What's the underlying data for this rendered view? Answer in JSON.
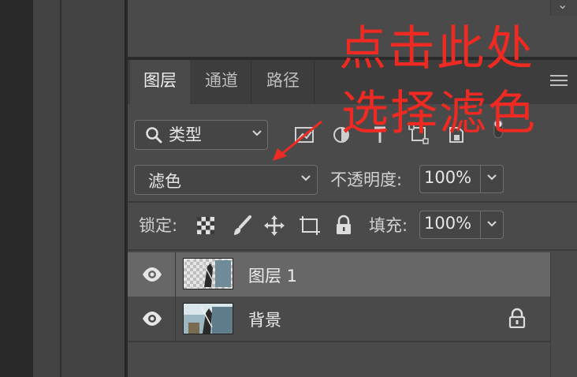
{
  "tabs": [
    {
      "label": "图层",
      "active": true
    },
    {
      "label": "通道",
      "active": false
    },
    {
      "label": "路径",
      "active": false
    }
  ],
  "filter": {
    "label": "类型",
    "icon": "search-icon"
  },
  "blend_mode": {
    "value": "滤色"
  },
  "opacity": {
    "label": "不透明度:",
    "value": "100%"
  },
  "lock": {
    "label": "锁定:"
  },
  "fill": {
    "label": "填充:",
    "value": "100%"
  },
  "layers": [
    {
      "name": "图层 1",
      "visible": true,
      "selected": true,
      "locked": false
    },
    {
      "name": "背景",
      "visible": true,
      "selected": false,
      "locked": true
    }
  ],
  "annotation": {
    "line1": "点击此处",
    "line2": "选择滤色",
    "color": "#ee2a22"
  },
  "colors": {
    "panel_bg": "#4a4a4a",
    "selected_row": "#676767",
    "tabbar_bg": "#3d3d3d"
  }
}
